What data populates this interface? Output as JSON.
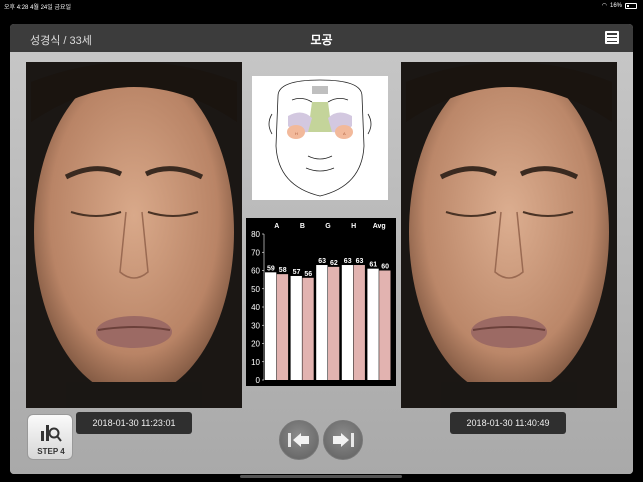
{
  "status_bar": {
    "time": "오후 4:28",
    "date": "4월 24일 금요일",
    "battery": "16%"
  },
  "header": {
    "patient": "성경식 / 33세",
    "title": "모공"
  },
  "photos": {
    "left_timestamp": "2018-01-30 11:23:01",
    "right_timestamp": "2018-01-30 11:40:49"
  },
  "step_button": {
    "label": "STEP 4"
  },
  "colors": {
    "bar_white": "#ffffff",
    "bar_pink": "#e2b3b0",
    "header_bg": "#3c3c3c"
  },
  "chart_data": {
    "type": "bar",
    "categories": [
      "A",
      "B",
      "G",
      "H",
      "Avg"
    ],
    "series": [
      {
        "values": [
          59,
          57,
          63,
          63,
          61
        ]
      },
      {
        "values": [
          58,
          56,
          62,
          63,
          60
        ]
      }
    ],
    "ylim": [
      0,
      80
    ],
    "yticks": [
      0,
      10,
      20,
      30,
      40,
      50,
      60,
      70,
      80
    ]
  }
}
